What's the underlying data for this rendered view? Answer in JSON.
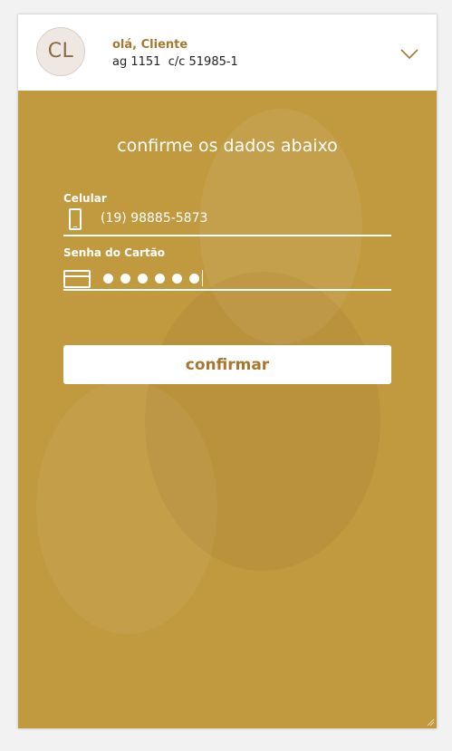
{
  "header": {
    "avatar_initials": "CL",
    "greeting": "olá, Cliente",
    "account": "ag 1151  c/c 51985-1",
    "expand_icon": "chevron-down-icon"
  },
  "form": {
    "title": "confirme os dados abaixo",
    "phone": {
      "label": "Celular",
      "value": "(19) 98885-5873",
      "icon": "phone-icon"
    },
    "password": {
      "label": "Senha do Cartão",
      "masked_length": 6,
      "icon": "credit-card-icon"
    },
    "submit_label": "confirmar"
  },
  "colors": {
    "accent": "#c1993f",
    "brand_text": "#a6782e",
    "page_bg": "#f2f2f2"
  }
}
